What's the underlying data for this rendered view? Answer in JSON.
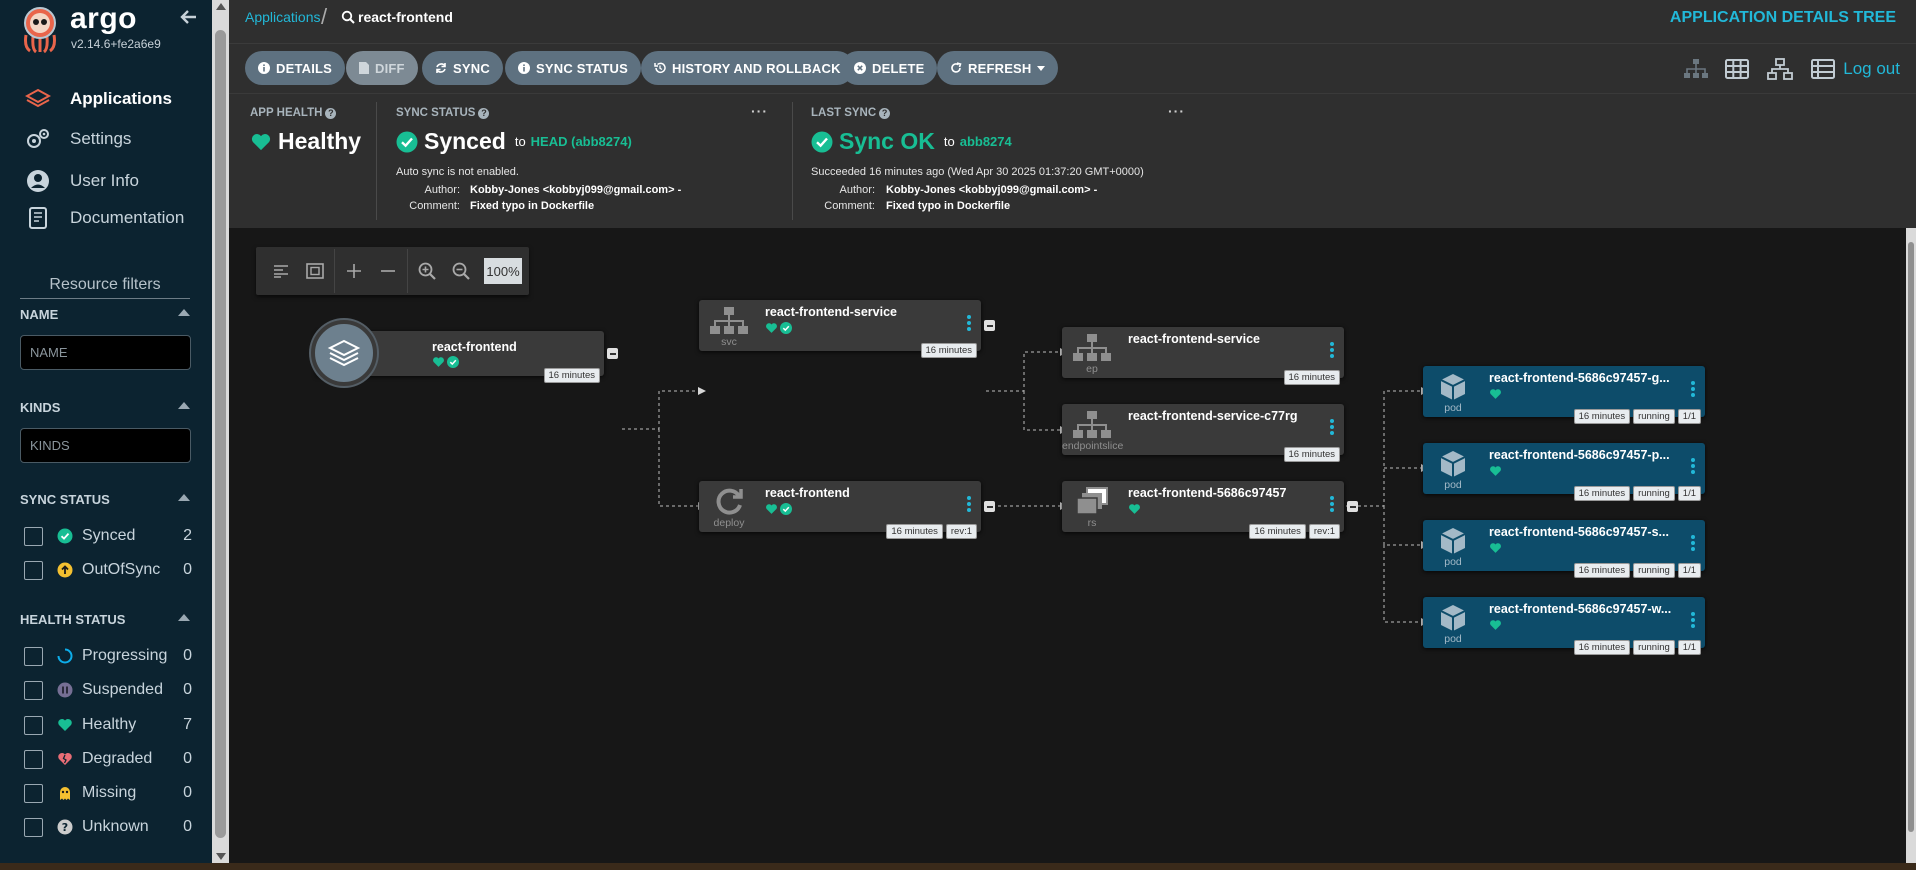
{
  "brand": {
    "name": "argo",
    "version": "v2.14.6+fe2a6e9"
  },
  "nav": [
    {
      "label": "Applications",
      "icon": "layers-icon",
      "active": true
    },
    {
      "label": "Settings",
      "icon": "gears-icon"
    },
    {
      "label": "User Info",
      "icon": "user-circle-icon"
    },
    {
      "label": "Documentation",
      "icon": "book-icon"
    }
  ],
  "filters": {
    "title": "Resource filters",
    "name_label": "NAME",
    "name_placeholder": "NAME",
    "kinds_label": "KINDS",
    "kinds_placeholder": "KINDS",
    "sync_label": "SYNC STATUS",
    "sync": [
      {
        "label": "Synced",
        "count": "2",
        "icon": "synced-icon",
        "color": "#18be94"
      },
      {
        "label": "OutOfSync",
        "count": "0",
        "icon": "outofsync-icon",
        "color": "#f4c030"
      }
    ],
    "health_label": "HEALTH STATUS",
    "health": [
      {
        "label": "Progressing",
        "count": "0",
        "icon": "progressing-icon",
        "color": "#0dadea"
      },
      {
        "label": "Suspended",
        "count": "0",
        "icon": "suspended-icon",
        "color": "#766f94"
      },
      {
        "label": "Healthy",
        "count": "7",
        "icon": "heart-icon",
        "color": "#18be94"
      },
      {
        "label": "Degraded",
        "count": "0",
        "icon": "broken-heart-icon",
        "color": "#e96d76"
      },
      {
        "label": "Missing",
        "count": "0",
        "icon": "ghost-icon",
        "color": "#f4c030"
      },
      {
        "label": "Unknown",
        "count": "0",
        "icon": "question-icon",
        "color": "#cccccc"
      }
    ]
  },
  "breadcrumb": {
    "root": "Applications",
    "current": "react-frontend"
  },
  "view_title": "APPLICATION DETAILS TREE",
  "toolbar": {
    "buttons": [
      "DETAILS",
      "DIFF",
      "SYNC",
      "SYNC STATUS",
      "HISTORY AND ROLLBACK",
      "DELETE",
      "REFRESH"
    ],
    "logout": "Log out"
  },
  "status": {
    "app_health": {
      "heading": "APP HEALTH",
      "value": "Healthy"
    },
    "sync_status": {
      "heading": "SYNC STATUS",
      "value": "Synced",
      "to": "to",
      "revision": "HEAD (abb8274)",
      "auto_sync": "Auto sync is not enabled.",
      "author_label": "Author:",
      "author": "Kobby-Jones <kobbyj099@gmail.com> -",
      "comment_label": "Comment:",
      "comment": "Fixed typo in Dockerfile"
    },
    "last_sync": {
      "heading": "LAST SYNC",
      "value": "Sync OK",
      "to": "to",
      "revision": "abb8274",
      "time": "Succeeded 16 minutes ago (Wed Apr 30 2025 01:37:20 GMT+0000)",
      "author_label": "Author:",
      "author": "Kobby-Jones <kobbyj099@gmail.com> -",
      "comment_label": "Comment:",
      "comment": "Fixed typo in Dockerfile"
    }
  },
  "graph": {
    "zoom": "100%",
    "app": {
      "name": "react-frontend",
      "age": "16 minutes"
    },
    "nodes": {
      "svc": {
        "name": "react-frontend-service",
        "kind": "svc",
        "age": "16 minutes"
      },
      "deploy": {
        "name": "react-frontend",
        "kind": "deploy",
        "age": "16 minutes",
        "rev": "rev:1"
      },
      "ep": {
        "name": "react-frontend-service",
        "kind": "ep",
        "age": "16 minutes"
      },
      "eps": {
        "name": "react-frontend-service-c77rg",
        "kind": "endpointslice",
        "age": "16 minutes"
      },
      "rs": {
        "name": "react-frontend-5686c97457",
        "kind": "rs",
        "age": "16 minutes",
        "rev": "rev:1"
      }
    },
    "pods": [
      {
        "name": "react-frontend-5686c97457-g...",
        "kind": "pod",
        "age": "16 minutes",
        "status": "running",
        "ready": "1/1"
      },
      {
        "name": "react-frontend-5686c97457-p...",
        "kind": "pod",
        "age": "16 minutes",
        "status": "running",
        "ready": "1/1"
      },
      {
        "name": "react-frontend-5686c97457-s...",
        "kind": "pod",
        "age": "16 minutes",
        "status": "running",
        "ready": "1/1"
      },
      {
        "name": "react-frontend-5686c97457-w...",
        "kind": "pod",
        "age": "16 minutes",
        "status": "running",
        "ready": "1/1"
      }
    ]
  }
}
